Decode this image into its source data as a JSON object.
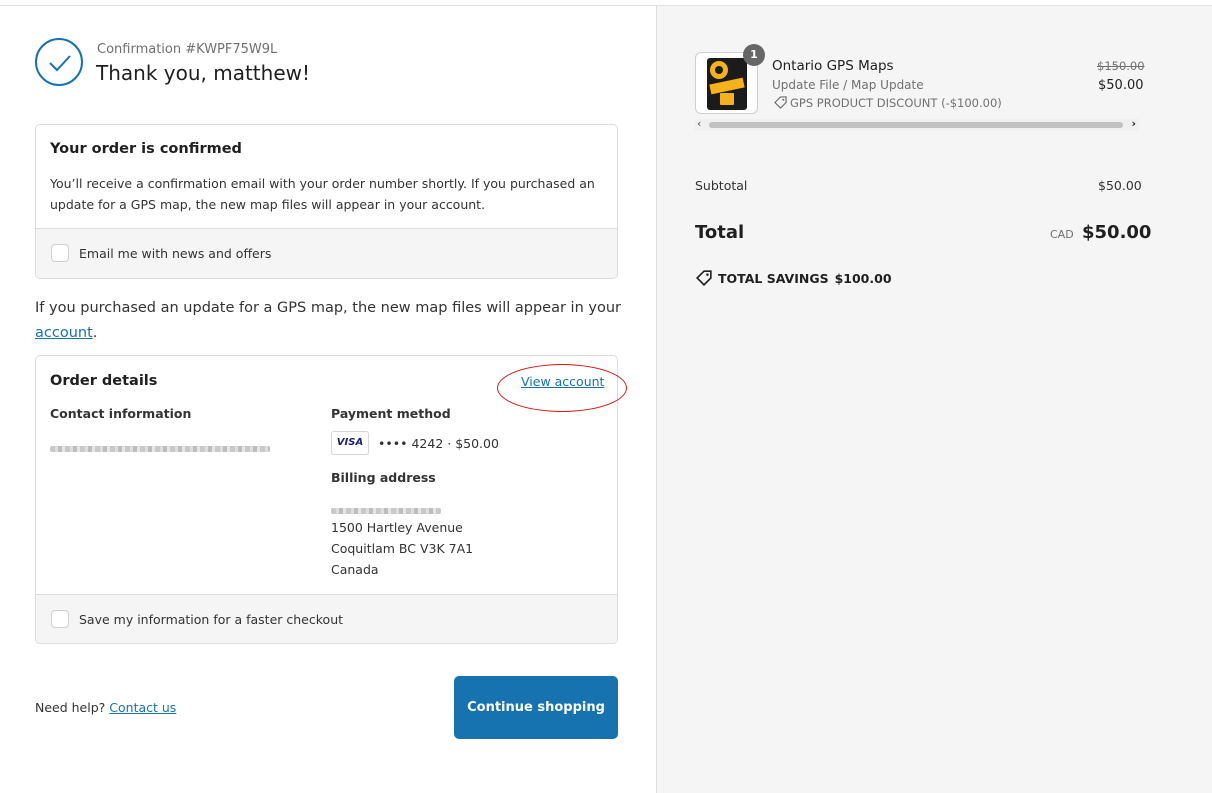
{
  "header": {
    "confirmation": "Confirmation #KWPF75W9L",
    "thanks": "Thank you, matthew!"
  },
  "confirmed_box": {
    "title": "Your order is confirmed",
    "text": "You’ll receive a confirmation email with your order number shortly. If you purchased an update for a GPS map, the new map files will appear in your account.",
    "email_opt_in_label": "Email me with news and offers"
  },
  "info_text": {
    "before": "If you purchased an update for a GPS map, the new map files will appear in your ",
    "link": "account",
    "after": "."
  },
  "order_details": {
    "title": "Order details",
    "view_account": "View account",
    "contact_label": "Contact information",
    "payment_label": "Payment method",
    "card_brand": "VISA",
    "card_info": "•••• 4242 · $50.00",
    "billing_label": "Billing address",
    "address_line1": "1500 Hartley Avenue",
    "address_line2": "Coquitlam BC V3K 7A1",
    "address_line3": "Canada",
    "save_info_label": "Save my information for a faster checkout"
  },
  "footer": {
    "need_help": "Need help?",
    "contact_us": "Contact us",
    "continue_button": "Continue shopping"
  },
  "summary": {
    "quantity": "1",
    "product_name": "Ontario GPS Maps",
    "variant": "Update File / Map Update",
    "discount": "GPS PRODUCT DISCOUNT (-$100.00)",
    "original_price": "$150.00",
    "price": "$50.00",
    "subtotal_label": "Subtotal",
    "subtotal_value": "$50.00",
    "total_label": "Total",
    "currency": "CAD",
    "total_value": "$50.00",
    "savings_label": "TOTAL SAVINGS",
    "savings_value": "$100.00"
  },
  "colors": {
    "accent": "#1773b0",
    "annotation": "#d01818"
  }
}
